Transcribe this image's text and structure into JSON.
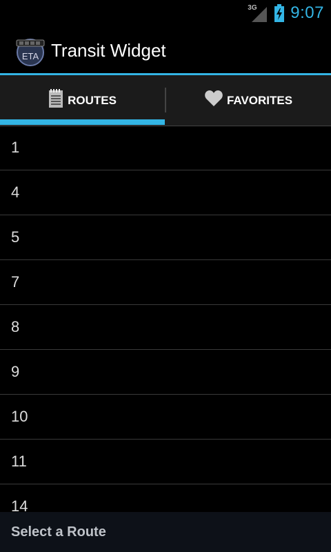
{
  "status_bar": {
    "network": "3G",
    "time": "9:07",
    "accent_color": "#33b5e5"
  },
  "action_bar": {
    "icon_text": "ETA",
    "title": "Transit Widget"
  },
  "tabs": [
    {
      "label": "ROUTES",
      "icon": "notepad-icon",
      "selected": true
    },
    {
      "label": "FAVORITES",
      "icon": "heart-icon",
      "selected": false
    }
  ],
  "routes": [
    "1",
    "4",
    "5",
    "7",
    "8",
    "9",
    "10",
    "11",
    "14"
  ],
  "bottom_bar": {
    "text": "Select a Route"
  }
}
